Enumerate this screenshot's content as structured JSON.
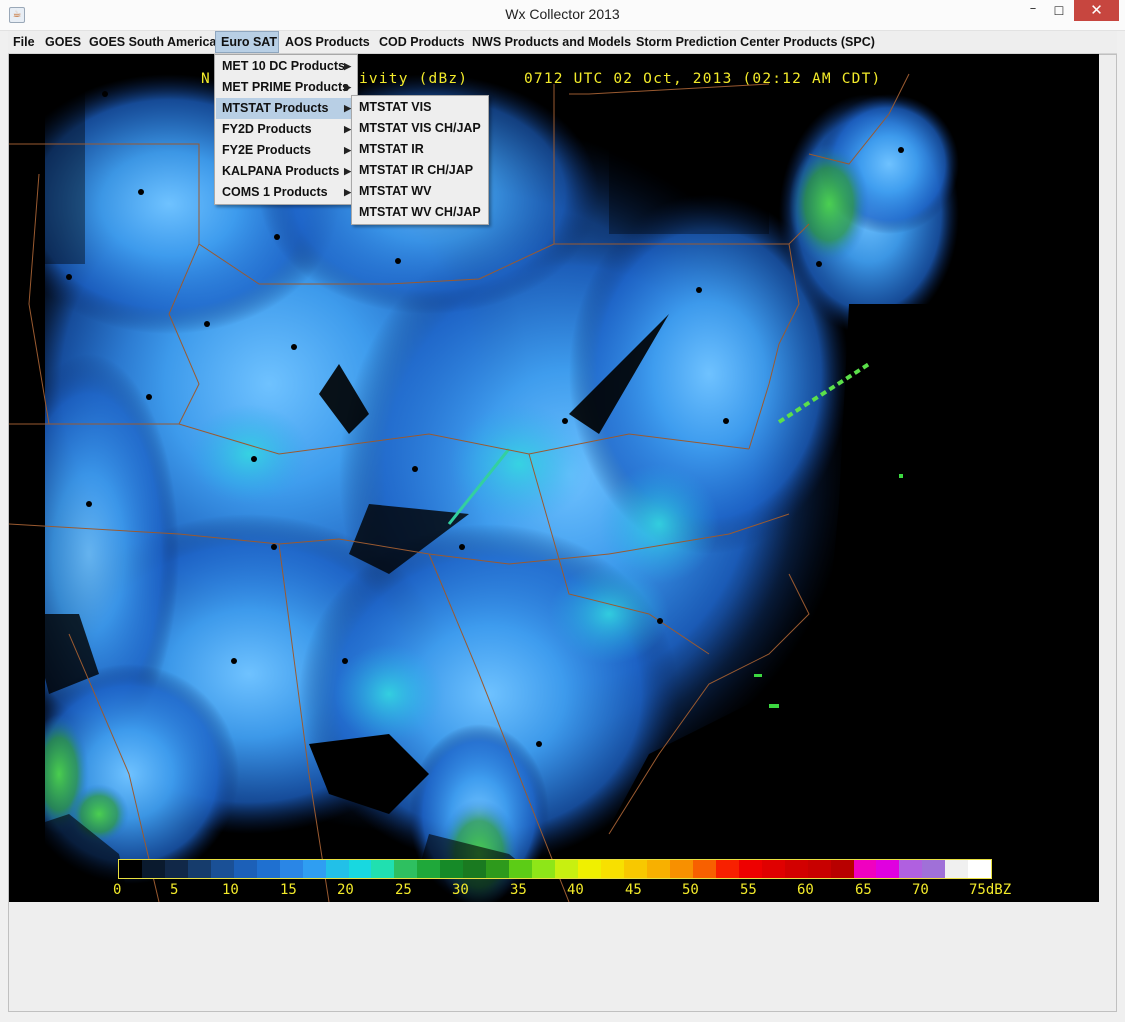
{
  "window": {
    "title": "Wx Collector 2013",
    "app_icon": "java-cup-icon",
    "controls": {
      "minimize": "–",
      "maximize": "☐",
      "close": "✕"
    }
  },
  "menubar": {
    "items": [
      {
        "label": "File"
      },
      {
        "label": "GOES"
      },
      {
        "label": "GOES South America"
      },
      {
        "label": "Euro SAT",
        "active": true
      },
      {
        "label": "AOS Products"
      },
      {
        "label": "COD Products"
      },
      {
        "label": "NWS Products and Models"
      },
      {
        "label": "Storm Prediction Center Products (SPC)"
      }
    ]
  },
  "euro_sat_menu": {
    "items": [
      {
        "label": "MET 10 DC Products"
      },
      {
        "label": "MET PRIME Products"
      },
      {
        "label": "MTSTAT Products",
        "highlighted": true
      },
      {
        "label": "FY2D Products"
      },
      {
        "label": "FY2E Products"
      },
      {
        "label": "KALPANA Products"
      },
      {
        "label": "COMS 1 Products"
      }
    ],
    "arrow_icon": "▶"
  },
  "mtstat_submenu": {
    "items": [
      {
        "label": "MTSTAT VIS"
      },
      {
        "label": "MTSTAT VIS CH/JAP"
      },
      {
        "label": "MTSTAT IR"
      },
      {
        "label": "MTSTAT IR CH/JAP"
      },
      {
        "label": "MTSTAT WV"
      },
      {
        "label": "MTSTAT WV CH/JAP"
      }
    ]
  },
  "radar": {
    "header_left": "N",
    "header_mid": "ivity (dBz)",
    "header_right": "0712 UTC 02 Oct, 2013 (02:12 AM CDT)",
    "scale_labels": [
      "0",
      "5",
      "10",
      "15",
      "20",
      "25",
      "30",
      "35",
      "40",
      "45",
      "50",
      "55",
      "60",
      "65",
      "70",
      "75dBZ"
    ],
    "colors": {
      "background": "#000000",
      "echo_light": "#1f6fd8",
      "echo_mid": "#3fa0f0",
      "echo_high": "#29c7d8",
      "echo_green": "#2ea83a",
      "borders": "#9a5a30",
      "label_yellow": "#f2ea2a"
    }
  }
}
